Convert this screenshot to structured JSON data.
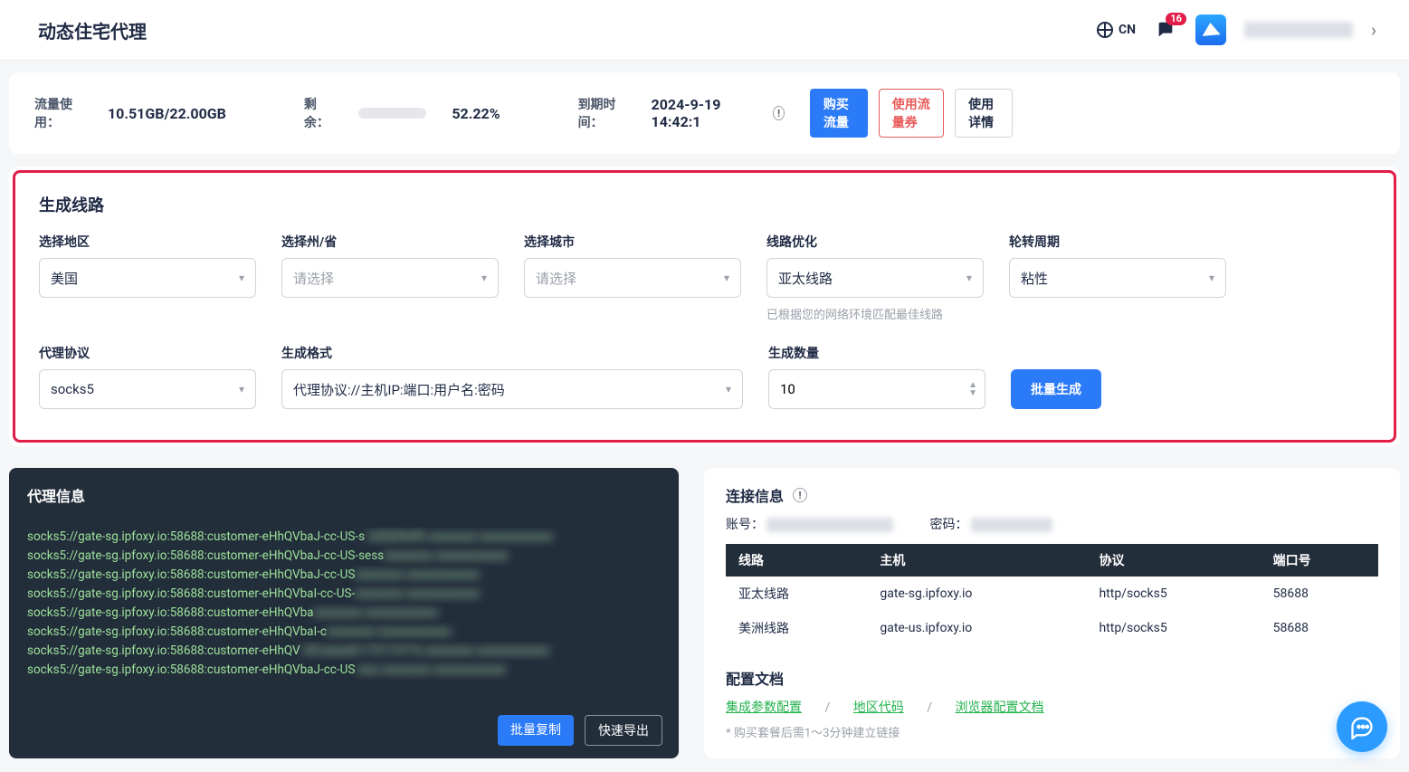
{
  "header": {
    "title": "动态住宅代理",
    "lang": "CN",
    "msg_count": "16"
  },
  "usage": {
    "label": "流量使用：",
    "value": "10.51GB/22.00GB",
    "remain_label": "剩余：",
    "percent": "52.22%",
    "expire_label": "到期时间：",
    "expire_value": "2024-9-19 14:42:1",
    "buy": "购买流量",
    "use_coupon": "使用流量券",
    "detail": "使用详情"
  },
  "gen": {
    "title": "生成线路",
    "region_label": "选择地区",
    "region_value": "美国",
    "state_label": "选择州/省",
    "state_placeholder": "请选择",
    "city_label": "选择城市",
    "city_placeholder": "请选择",
    "route_label": "线路优化",
    "route_value": "亚太线路",
    "route_hint": "已根据您的网络环境匹配最佳线路",
    "cycle_label": "轮转周期",
    "cycle_value": "粘性",
    "protocol_label": "代理协议",
    "protocol_value": "socks5",
    "format_label": "生成格式",
    "format_value": "代理协议://主机IP:端口:用户名:密码",
    "count_label": "生成数量",
    "count_value": "10",
    "button": "批量生成"
  },
  "proxy": {
    "title": "代理信息",
    "linesA": [
      "socks5://gate-sg.ipfoxy.io:58688:customer-eHhQVbaJ-cc-US-s",
      "socks5://gate-sg.ipfoxy.io:58688:customer-eHhQVbaJ-cc-US-sess",
      "socks5://gate-sg.ipfoxy.io:58688:customer-eHhQVbaJ-cc-US",
      "socks5://gate-sg.ipfoxy.io:58688:customer-eHhQVbaI-cc-US-",
      "socks5://gate-sg.ipfoxy.io:58688:customer-eHhQVba",
      "socks5://gate-sg.ipfoxy.io:58688:customer-eHhQVbaI-c",
      "socks5://gate-sg.ipfoxy.io:58688:customer-eHhQV",
      "socks5://gate-sg.ipfoxy.io:58688:customer-eHhQVbaJ-cc-US"
    ],
    "linesB": [
      "U2QCKxfG",
      "",
      "",
      "",
      "",
      "",
      "US-sessId-17217277s",
      "soo"
    ],
    "copy": "批量复制",
    "export": "快速导出"
  },
  "conn": {
    "title": "连接信息",
    "acct_label": "账号：",
    "pwd_label": "密码：",
    "headers": {
      "route": "线路",
      "host": "主机",
      "proto": "协议",
      "port": "端口号"
    },
    "rows": [
      {
        "route": "亚太线路",
        "host": "gate-sg.ipfoxy.io",
        "proto": "http/socks5",
        "port": "58688"
      },
      {
        "route": "美洲线路",
        "host": "gate-us.ipfoxy.io",
        "proto": "http/socks5",
        "port": "58688"
      }
    ],
    "docs_title": "配置文档",
    "docs": {
      "a": "集成参数配置",
      "b": "地区代码",
      "c": "浏览器配置文档"
    },
    "note": "* 购买套餐后需1～3分钟建立链接"
  }
}
